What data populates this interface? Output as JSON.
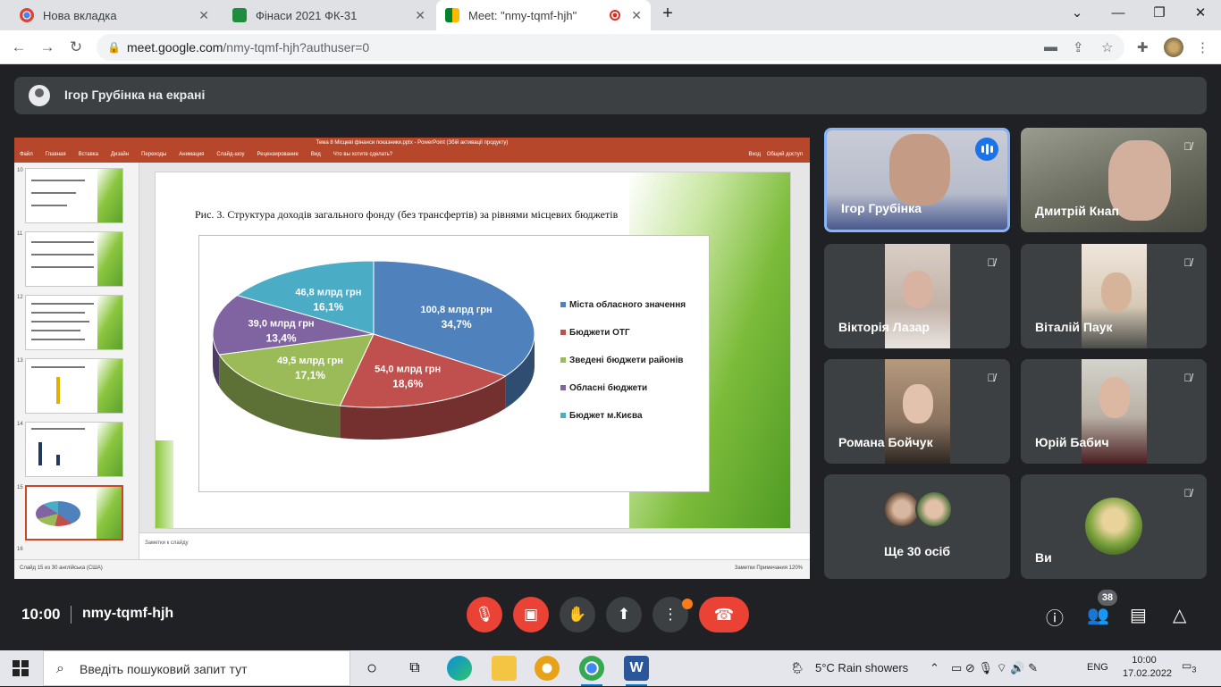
{
  "browser": {
    "tabs": [
      {
        "label": "Нова вкладка"
      },
      {
        "label": "Фінаси 2021 ФК-31"
      },
      {
        "label": "Meet: \"nmy-tqmf-hjh\""
      }
    ],
    "url_host": "meet.google.com",
    "url_path": "/nmy-tqmf-hjh?authuser=0"
  },
  "meet": {
    "presenter_label": "Ігор Грубінка на екрані",
    "presentation": {
      "window_title": "Тема 8 Місцеві фінанси показники.pptx - PowerPoint (Збій активації продукту)",
      "menu": [
        "Файл",
        "Главная",
        "Вставка",
        "Дизайн",
        "Переходы",
        "Анимация",
        "Слайд-шоу",
        "Рецензирование",
        "Вид",
        "Что вы хотите сделать?"
      ],
      "menu_right": [
        "Вход",
        "Общий доступ"
      ],
      "thumb_numbers": [
        "10",
        "11",
        "12",
        "13",
        "14",
        "15",
        "16"
      ],
      "slide_caption": "Рис. 3. Структура доходів загального фонду (без трансфертів) за рівнями місцевих бюджетів",
      "notes_placeholder": "Заметки к слайду",
      "status_left": "Слайд 15 из 30   англійська (США)",
      "status_right": "Заметки   Примечания   120%"
    },
    "participants": [
      {
        "name": "Ігор Грубінка"
      },
      {
        "name": "Дмитрій Кнап"
      },
      {
        "name": "Вікторія Лазар"
      },
      {
        "name": "Віталій Паук"
      },
      {
        "name": "Романа Бойчук"
      },
      {
        "name": "Юрій Бабич"
      },
      {
        "name": "Ще 30 осіб"
      },
      {
        "name": "Ви"
      }
    ],
    "time": "10:00",
    "meeting_code": "nmy-tqmf-hjh",
    "people_count": "38"
  },
  "chart_data": {
    "type": "pie",
    "title": "",
    "slices": [
      {
        "name": "Міста обласного значення",
        "amount": "100,8 млрд грн",
        "percent": "34,7%",
        "value": 34.7,
        "color": "#4f81bd"
      },
      {
        "name": "Бюджети ОТГ",
        "amount": "54,0 млрд грн",
        "percent": "18,6%",
        "value": 18.6,
        "color": "#c0504d"
      },
      {
        "name": "Зведені бюджети районів",
        "amount": "49,5 млрд грн",
        "percent": "17,1%",
        "value": 17.1,
        "color": "#9bbb59"
      },
      {
        "name": "Обласні бюджети",
        "amount": "39,0 млрд грн",
        "percent": "13,4%",
        "value": 13.4,
        "color": "#8064a2"
      },
      {
        "name": "Бюджет м.Києва",
        "amount": "46,8 млрд грн",
        "percent": "16,1%",
        "value": 16.1,
        "color": "#4bacc6"
      }
    ],
    "legend_position": "right"
  },
  "taskbar": {
    "search_placeholder": "Введіть пошуковий запит тут",
    "weather": "5°C  Rain showers",
    "language": "ENG",
    "time": "10:00",
    "date": "17.02.2022",
    "notifications": "3"
  }
}
